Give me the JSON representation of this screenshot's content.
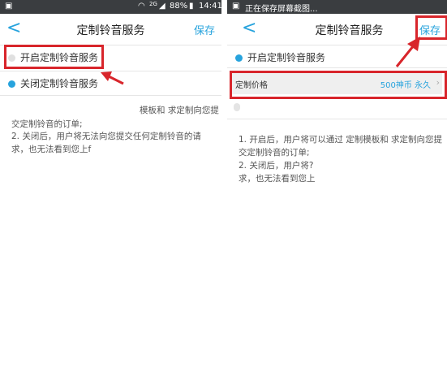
{
  "left": {
    "status": {
      "network": "2G",
      "battery": "88%",
      "time": "14:41"
    },
    "nav": {
      "back": "<",
      "title": "定制铃音服务",
      "save": "保存"
    },
    "options": {
      "enable": "开启定制铃音服务",
      "disable": "关闭定制铃音服务"
    },
    "desc": {
      "line1": "模板和 求定制向您提",
      "line2": "交定制铃音的订单;",
      "line3": "2. 关闭后，用户将无法向您提交任何定制铃音的请",
      "line4": "求，也无法看到您上f"
    }
  },
  "right": {
    "status": {
      "text": "正在保存屏幕截图..."
    },
    "nav": {
      "back": "<",
      "title": "定制铃音服务",
      "save": "保存"
    },
    "options": {
      "enable": "开启定制铃音服务"
    },
    "price": {
      "label": "定制价格",
      "value": "500神币 永久",
      "chevron": "›"
    },
    "desc": {
      "line1": "1. 开启后，用户将可以通过 定制模板和 求定制向您提",
      "line2": "交定制铃音的订单;",
      "line3": "2. 关闭后，用户将?",
      "line4": "求，也无法看到您上"
    }
  },
  "colors": {
    "accent": "#27a3dd",
    "highlight": "#d8252b",
    "statusbar": "#3a3d40"
  }
}
